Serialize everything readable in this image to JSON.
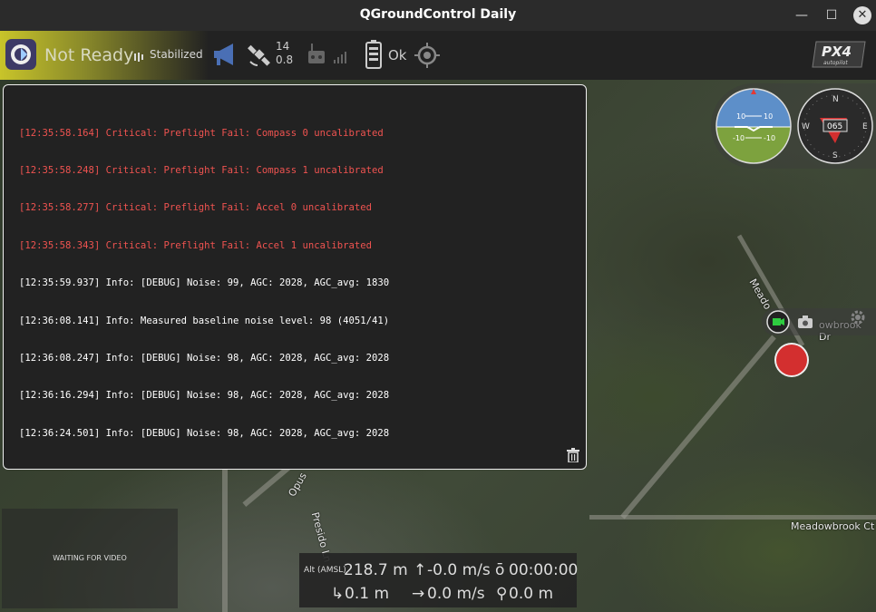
{
  "window": {
    "title": "QGroundControl Daily"
  },
  "toolbar": {
    "status": "Not Ready",
    "flight_mode": "Stabilized",
    "gps": {
      "satellites": "14",
      "hdop": "0.8"
    },
    "battery_status": "Ok",
    "brand": "PX4 autopilot"
  },
  "console": {
    "messages": [
      {
        "text": "[12:35:58.164] Critical: Preflight Fail: Compass 0 uncalibrated",
        "level": "critical"
      },
      {
        "text": "[12:35:58.248] Critical: Preflight Fail: Compass 1 uncalibrated",
        "level": "critical"
      },
      {
        "text": "[12:35:58.277] Critical: Preflight Fail: Accel 0 uncalibrated",
        "level": "critical"
      },
      {
        "text": "[12:35:58.343] Critical: Preflight Fail: Accel 1 uncalibrated",
        "level": "critical"
      },
      {
        "text": "[12:35:59.937] Info: [DEBUG] Noise: 99, AGC: 2028, AGC_avg: 1830",
        "level": "info"
      },
      {
        "text": "[12:36:08.141] Info: Measured baseline noise level: 98 (4051/41)",
        "level": "info"
      },
      {
        "text": "[12:36:08.247] Info: [DEBUG] Noise: 98, AGC: 2028, AGC_avg: 2028",
        "level": "info"
      },
      {
        "text": "[12:36:16.294] Info: [DEBUG] Noise: 98, AGC: 2028, AGC_avg: 2028",
        "level": "info"
      },
      {
        "text": "[12:36:24.501] Info: [DEBUG] Noise: 98, AGC: 2028, AGC_avg: 2028",
        "level": "info"
      }
    ]
  },
  "attitude": {
    "pitch_up": "10",
    "pitch_down": "-10"
  },
  "compass": {
    "heading": "065",
    "north": "N",
    "south": "S",
    "east": "E",
    "west": "W"
  },
  "map": {
    "labels": {
      "meadowbrook_ct": "Meadowbrook Ct",
      "meadow": "Meado",
      "owbrook_dr": "owbrook Dr",
      "presido": "Presido Ln",
      "opus": "Opus"
    }
  },
  "video": {
    "status": "WAITING FOR VIDEO"
  },
  "telemetry": {
    "alt_label": "Alt (AMSL)",
    "altitude": "218.7 m",
    "vertical_speed": "-0.0 m/s",
    "flight_time": "00:00:00",
    "distance": "0.1 m",
    "ground_speed": "0.0 m/s",
    "distance_home": "0.0 m"
  },
  "colors": {
    "critical": "#ef5350",
    "info": "#ffffff",
    "record": "#d32f2f",
    "accent_ready": "#c8c42a"
  }
}
